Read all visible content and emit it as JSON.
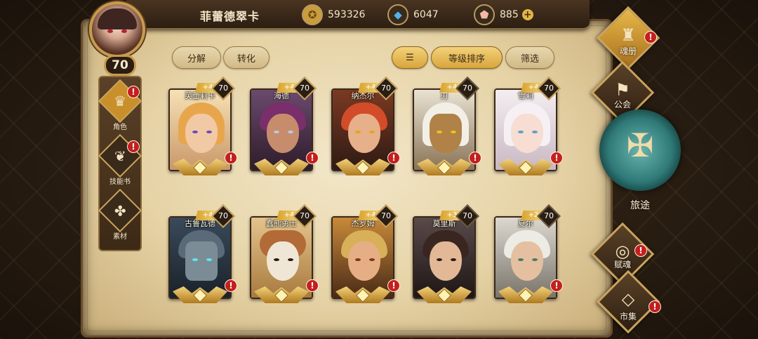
{
  "header": {
    "player_name": "菲蕾德翠卡",
    "player_level": "70",
    "gold": "593326",
    "crystal": "6047",
    "gem": "885",
    "gold_icon": "coin-icon",
    "crystal_icon": "blue-crystal-icon",
    "gem_icon": "pink-gem-icon"
  },
  "left_nav": [
    {
      "label": "角色",
      "icon": "character-icon",
      "alert": "!"
    },
    {
      "label": "技能书",
      "icon": "skill-book-icon",
      "alert": "!"
    },
    {
      "label": "素材",
      "icon": "material-icon"
    }
  ],
  "toolbar": {
    "decompose": "分解",
    "convert": "转化",
    "sort_order": "等级排序",
    "filter": "筛选"
  },
  "cards": [
    {
      "name": "芙蕾莉卡",
      "plus": "+4",
      "level": "70"
    },
    {
      "name": "海德",
      "plus": "+4",
      "level": "70"
    },
    {
      "name": "纳杰尔",
      "plus": "+4",
      "level": "70"
    },
    {
      "name": "刃",
      "plus": "+4",
      "level": "70"
    },
    {
      "name": "雪莉",
      "plus": "+4",
      "level": "70"
    },
    {
      "name": "古鲁瓦德",
      "plus": "+4",
      "level": "70"
    },
    {
      "name": "蠢熊勇士",
      "plus": "+4",
      "level": "70"
    },
    {
      "name": "杰罗姆",
      "plus": "+4",
      "level": "70"
    },
    {
      "name": "莫里斯",
      "plus": "+3",
      "level": "70"
    },
    {
      "name": "夏尔",
      "plus": "+2",
      "level": "70"
    }
  ],
  "right_nav": {
    "soul_book": "魂册",
    "guild": "公会",
    "journey": "旅途",
    "talent": "赋魂",
    "market": "市集",
    "alert": "!"
  },
  "colors": {
    "accent_gold": "#d8a53c",
    "alert_red": "#c41f1f",
    "journey_teal": "#2f7a78"
  }
}
